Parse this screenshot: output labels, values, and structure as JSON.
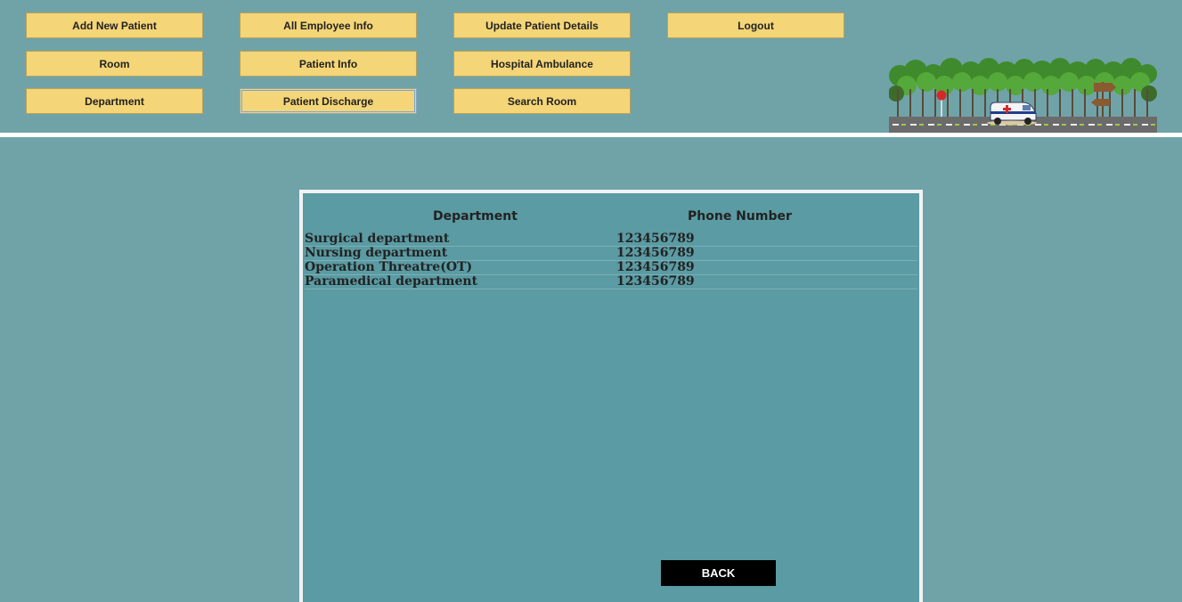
{
  "nav": {
    "add_new_patient": "Add New Patient",
    "all_employee_info": "All Employee Info",
    "update_patient_details": "Update Patient Details",
    "logout": "Logout",
    "room": "Room",
    "patient_info": "Patient Info",
    "hospital_ambulance": "Hospital Ambulance",
    "department": "Department",
    "patient_discharge": "Patient Discharge",
    "search_room": "Search Room"
  },
  "table": {
    "headers": [
      "Department",
      "Phone Number"
    ],
    "rows": [
      {
        "department": "Surgical department",
        "phone": "123456789"
      },
      {
        "department": "Nursing department",
        "phone": "123456789"
      },
      {
        "department": "Operation Threatre(OT)",
        "phone": "123456789"
      },
      {
        "department": "Paramedical department",
        "phone": "123456789"
      }
    ]
  },
  "back_label": "BACK",
  "colors": {
    "background": "#6fa3a8",
    "panel": "#5b9ba3",
    "button": "#f4d577",
    "back_button": "#000000"
  }
}
